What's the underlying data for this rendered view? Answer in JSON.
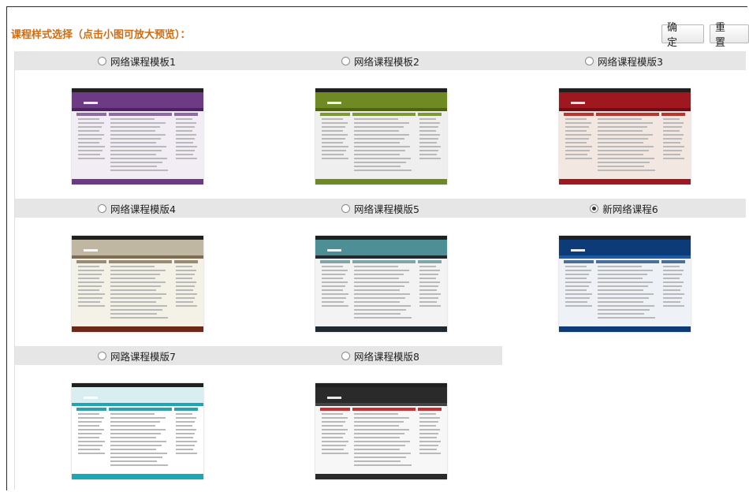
{
  "page": {
    "title": "课程样式选择（点击小图可放大预览）：",
    "buttons": {
      "confirm": "确 定",
      "reset": "重 置"
    },
    "selected_index": 5
  },
  "templates": [
    {
      "label": "网络课程模板1",
      "selected": false,
      "colors": {
        "banner": "#6d3a86",
        "nav": "#4b245f",
        "hdr": "#8c6da0",
        "bg": "#f2edf4",
        "foot": "#6d3a86"
      }
    },
    {
      "label": "网络课程模板2",
      "selected": false,
      "colors": {
        "banner": "#6f8a22",
        "nav": "#4e6314",
        "hdr": "#7f9a35",
        "bg": "#efefef",
        "foot": "#6f8a22"
      }
    },
    {
      "label": "网络课程模版3",
      "selected": false,
      "colors": {
        "banner": "#a0181f",
        "nav": "#6e0e14",
        "hdr": "#b9362f",
        "bg": "#f3e7e2",
        "foot": "#a0181f"
      }
    },
    {
      "label": "网络课程模版4",
      "selected": false,
      "colors": {
        "banner": "#bfb7a1",
        "nav": "#7d6b52",
        "hdr": "#9b8b70",
        "bg": "#f4f1e7",
        "foot": "#6a2a17"
      }
    },
    {
      "label": "网络课程模版5",
      "selected": false,
      "colors": {
        "banner": "#4e8f95",
        "nav": "#1f2a30",
        "hdr": "#7fa4a9",
        "bg": "#f3f3f3",
        "foot": "#1f2a30"
      }
    },
    {
      "label": "新网络课程6",
      "selected": true,
      "colors": {
        "banner": "#0d3b77",
        "nav": "#1e5aa5",
        "hdr": "#4a6f9b",
        "bg": "#eef2f6",
        "foot": "#0d3b77"
      }
    },
    {
      "label": "网路课程模版7",
      "selected": false,
      "colors": {
        "banner": "#d9eef0",
        "nav": "#1aa8b4",
        "hdr": "#2aa0a8",
        "bg": "#ffffff",
        "foot": "#1aa8b4"
      }
    },
    {
      "label": "网络课程模版8",
      "selected": false,
      "colors": {
        "banner": "#2a2a2a",
        "nav": "#444444",
        "hdr": "#c53030",
        "bg": "#f7f7f7",
        "foot": "#2a2a2a"
      }
    }
  ]
}
